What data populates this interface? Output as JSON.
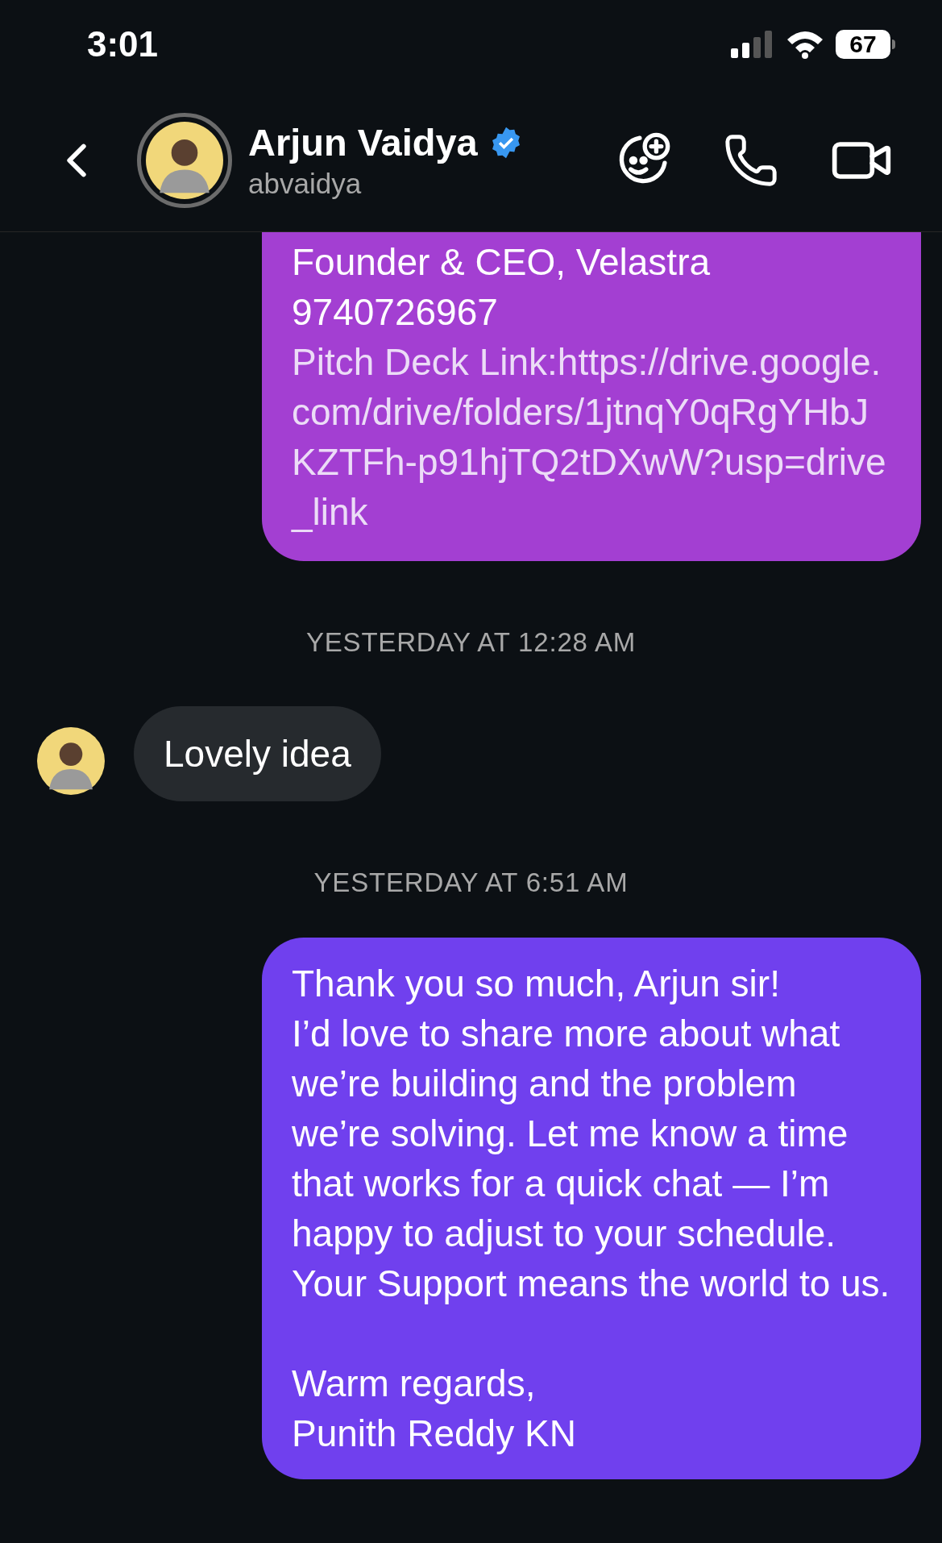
{
  "status_bar": {
    "time": "3:01",
    "battery": "67"
  },
  "header": {
    "name": "Arjun Vaidya",
    "username": "abvaidya",
    "verified": true
  },
  "messages": [
    {
      "kind": "outgoing",
      "color": "#a33fd2",
      "text": "Founder & CEO, Velastra\n9740726967",
      "link_text": "Pitch Deck Link:https://drive.google.com/drive/folders/1jtnqY0qRgYHbJKZTFh-p91hjTQ2tDXwW?usp=drive_link"
    },
    {
      "kind": "timestamp",
      "text": "YESTERDAY AT 12:28 AM"
    },
    {
      "kind": "incoming",
      "text": "Lovely idea"
    },
    {
      "kind": "timestamp",
      "text": "YESTERDAY AT 6:51 AM"
    },
    {
      "kind": "outgoing",
      "color": "#7040ee",
      "text": "Thank you so much, Arjun sir!\nI’d love to share more about what we’re building and the problem we’re solving. Let me know a time that works for a quick chat — I’m happy to adjust to your schedule. Your Support means the world to us.\n\nWarm regards,\nPunith Reddy KN"
    }
  ]
}
